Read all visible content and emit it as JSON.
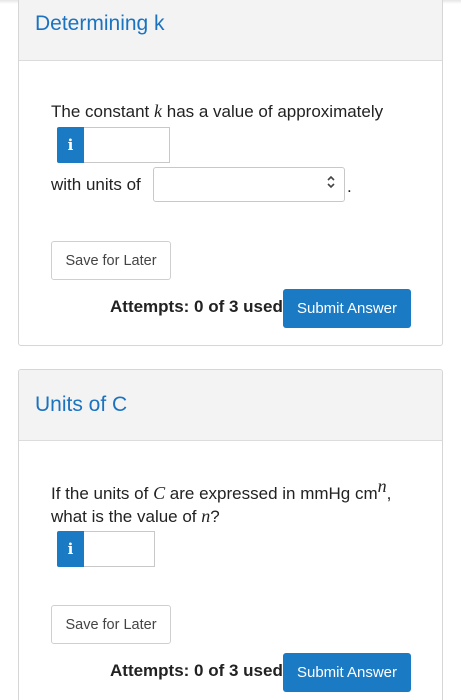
{
  "card1": {
    "title": "Determining k",
    "question_prefix": "The constant ",
    "question_var": "k",
    "question_suffix": " has a value of approximately",
    "info_label": "i",
    "answer_value": "",
    "units_label": "with units of",
    "units_selected": "",
    "units_period": ".",
    "save_label": "Save for Later",
    "attempts_label": "Attempts: 0 of 3 used",
    "submit_label": "Submit Answer"
  },
  "card2": {
    "title": "Units of C",
    "q_part1": "If the units of ",
    "q_var_c": "C",
    "q_part2": " are expressed in mmHg cm",
    "q_sup": "n",
    "q_part3": ",",
    "q_line2_part1": "what is the value of ",
    "q_var_n": "n",
    "q_line2_part2": "?",
    "info_label": "i",
    "answer_value": "",
    "save_label": "Save for Later",
    "attempts_label": "Attempts: 0 of 3 used",
    "submit_label": "Submit Answer"
  },
  "colors": {
    "accent": "#1a7ac4",
    "title": "#1b73c0",
    "header_bg": "#f3f3f3"
  },
  "icons": {
    "info": "info-icon",
    "select_arrows": "chevron-up-down-icon"
  }
}
